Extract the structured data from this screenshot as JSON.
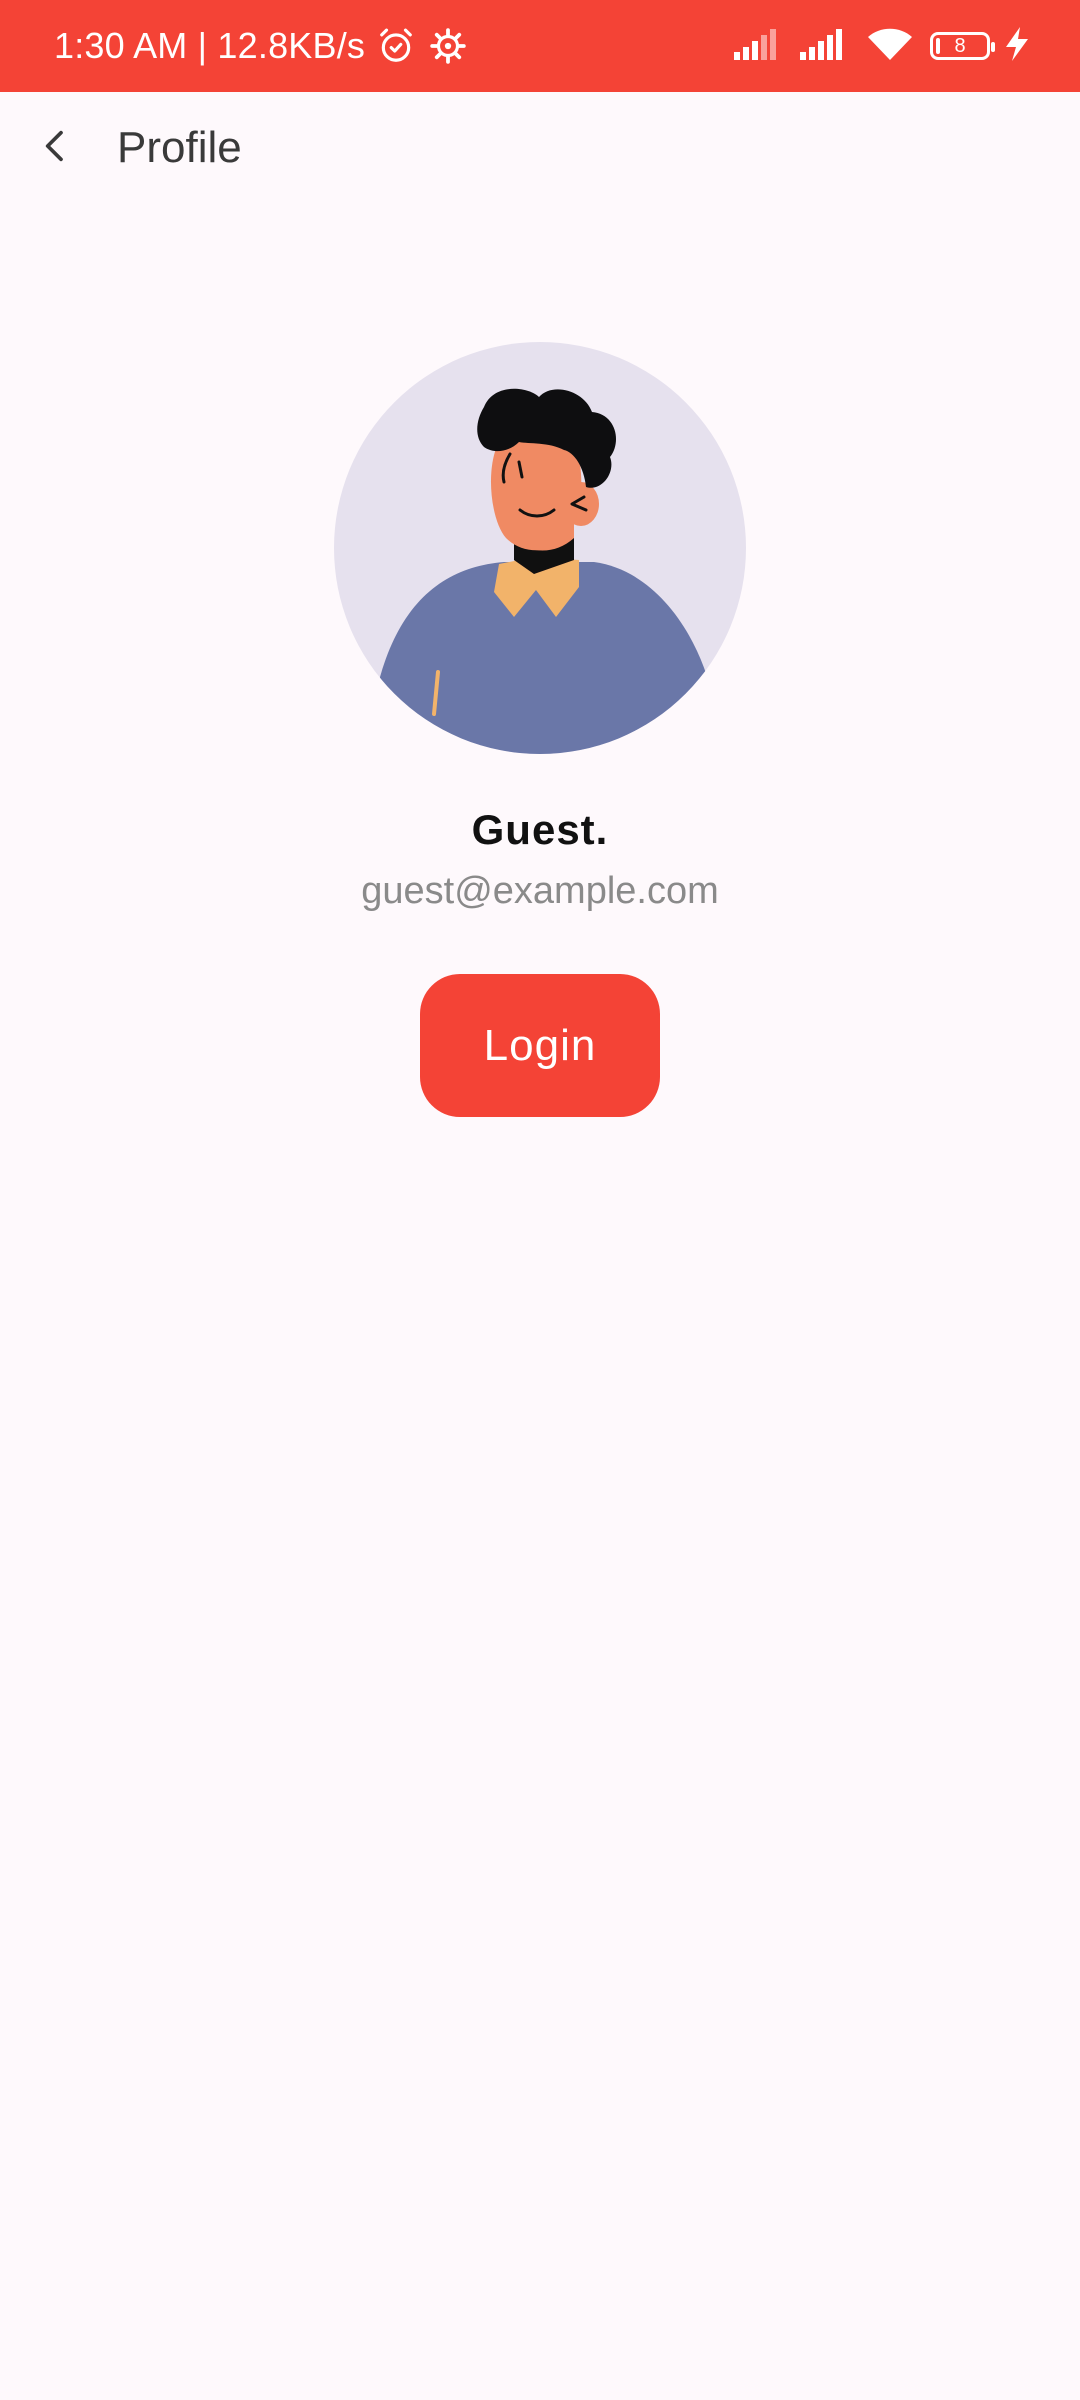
{
  "status_bar": {
    "time_and_speed": "1:30 AM | 12.8KB/s",
    "icons": [
      "alarm-icon",
      "settings-icon",
      "signal-1-icon",
      "signal-2-icon",
      "wifi-icon",
      "battery-icon",
      "charging-icon"
    ],
    "battery_level": "8",
    "battery_fraction": 0.08,
    "background_color": "#F44336"
  },
  "app_bar": {
    "back_icon": "chevron-left-icon",
    "title": "Profile"
  },
  "profile": {
    "avatar_icon": "person-avatar-illustration",
    "name": "Guest.",
    "email": "guest@example.com"
  },
  "actions": {
    "login_label": "Login",
    "login_color": "#F44336"
  },
  "colors": {
    "page_background": "#FEF9FC",
    "accent": "#F44336"
  }
}
